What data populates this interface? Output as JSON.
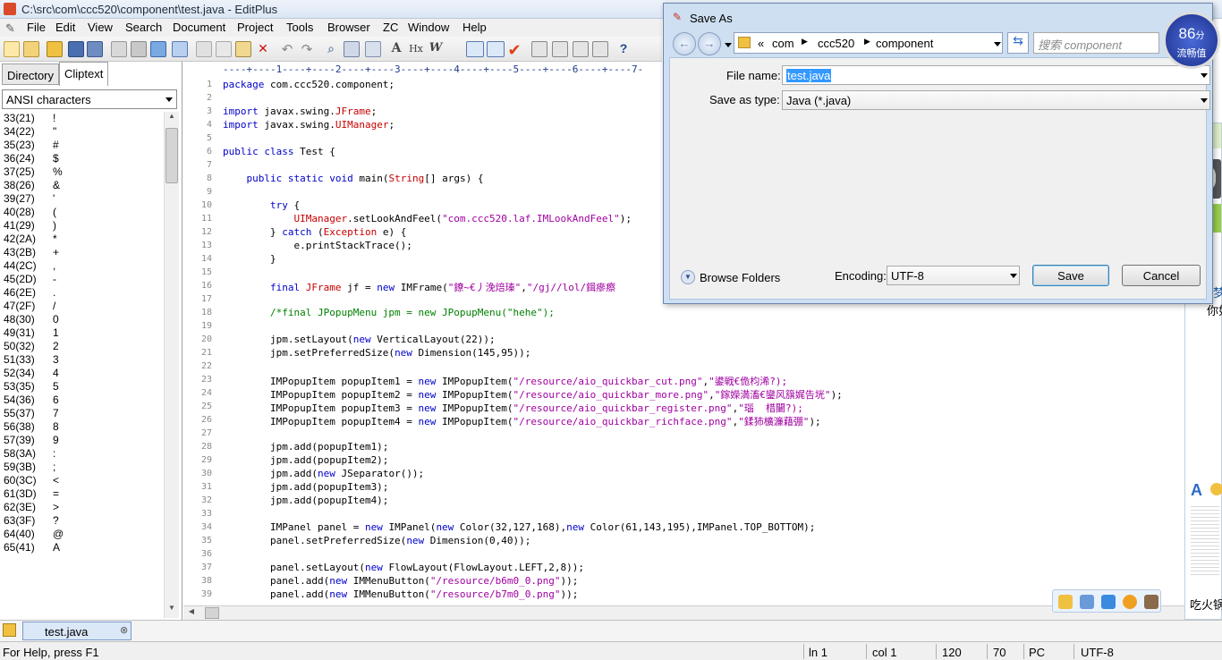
{
  "window": {
    "title": "C:\\src\\com\\ccc520\\component\\test.java - EditPlus"
  },
  "menu": [
    "File",
    "Edit",
    "View",
    "Search",
    "Document",
    "Project",
    "Tools",
    "Browser",
    "ZC",
    "Window",
    "Help"
  ],
  "left_panel": {
    "tabs": [
      "Directory",
      "Cliptext"
    ],
    "charset": "ANSI characters",
    "chars": [
      [
        "33(21)",
        "!"
      ],
      [
        "34(22)",
        "\""
      ],
      [
        "35(23)",
        "#"
      ],
      [
        "36(24)",
        "$"
      ],
      [
        "37(25)",
        "%"
      ],
      [
        "38(26)",
        "&"
      ],
      [
        "39(27)",
        "'"
      ],
      [
        "40(28)",
        "("
      ],
      [
        "41(29)",
        ")"
      ],
      [
        "42(2A)",
        "*"
      ],
      [
        "43(2B)",
        "+"
      ],
      [
        "44(2C)",
        ","
      ],
      [
        "45(2D)",
        "-"
      ],
      [
        "46(2E)",
        "."
      ],
      [
        "47(2F)",
        "/"
      ],
      [
        "48(30)",
        "0"
      ],
      [
        "49(31)",
        "1"
      ],
      [
        "50(32)",
        "2"
      ],
      [
        "51(33)",
        "3"
      ],
      [
        "52(34)",
        "4"
      ],
      [
        "53(35)",
        "5"
      ],
      [
        "54(36)",
        "6"
      ],
      [
        "55(37)",
        "7"
      ],
      [
        "56(38)",
        "8"
      ],
      [
        "57(39)",
        "9"
      ],
      [
        "58(3A)",
        ":"
      ],
      [
        "59(3B)",
        ";"
      ],
      [
        "60(3C)",
        "<"
      ],
      [
        "61(3D)",
        "="
      ],
      [
        "62(3E)",
        ">"
      ],
      [
        "63(3F)",
        "?"
      ],
      [
        "64(40)",
        "@"
      ],
      [
        "65(41)",
        "A"
      ]
    ]
  },
  "editor": {
    "ruler": "----+----1----+----2----+----3----+----4----+----5----+----6----+----7-",
    "lines": [
      {
        "n": "1",
        "t": "package com.ccc520.component;"
      },
      {
        "n": "2",
        "t": ""
      },
      {
        "n": "3",
        "t": "import javax.swing.JFrame;"
      },
      {
        "n": "4",
        "t": "import javax.swing.UIManager;"
      },
      {
        "n": "5",
        "t": ""
      },
      {
        "n": "6",
        "t": "public class Test {"
      },
      {
        "n": "7",
        "t": ""
      },
      {
        "n": "8",
        "t": "    public static void main(String[] args) {"
      },
      {
        "n": "9",
        "t": ""
      },
      {
        "n": "10",
        "t": "        try {"
      },
      {
        "n": "11",
        "t": "            UIManager.setLookAndFeel(\"com.ccc520.laf.IMLookAndFeel\");"
      },
      {
        "n": "12",
        "t": "        } catch (Exception e) {"
      },
      {
        "n": "13",
        "t": "            e.printStackTrace();"
      },
      {
        "n": "14",
        "t": "        }"
      },
      {
        "n": "15",
        "t": ""
      },
      {
        "n": "16",
        "t": "        final JFrame jf = new IMFrame(\"鐐~€丿浼焙瑧\",\"/gj//lol/鍓瘮瘵"
      },
      {
        "n": "17",
        "t": ""
      },
      {
        "n": "18",
        "t": "        /*final JPopupMenu jpm = new JPopupMenu(\"hehe\");"
      },
      {
        "n": "19",
        "t": ""
      },
      {
        "n": "20",
        "t": "        jpm.setLayout(new VerticalLayout(22));"
      },
      {
        "n": "21",
        "t": "        jpm.setPreferredSize(new Dimension(145,95));"
      },
      {
        "n": "22",
        "t": ""
      },
      {
        "n": "23",
        "t": "        IMPopupItem popupItem1 = new IMPopupItem(\"/resource/aio_quickbar_cut.png\",\"鍙戦€佹枃浠?);"
      },
      {
        "n": "24",
        "t": "        IMPopupItem popupItem2 = new IMPopupItem(\"/resource/aio_quickbar_more.png\",\"鎵嬫満滀€鑾风簱娓告垙\");"
      },
      {
        "n": "25",
        "t": "        IMPopupItem popupItem3 = new IMPopupItem(\"/resource/aio_quickbar_register.png\",\"瑙  棤闄?);"
      },
      {
        "n": "26",
        "t": "        IMPopupItem popupItem4 = new IMPopupItem(\"/resource/aio_quickbar_richface.png\",\"鍒犻櫎濂藉弸\");"
      },
      {
        "n": "27",
        "t": ""
      },
      {
        "n": "28",
        "t": "        jpm.add(popupItem1);"
      },
      {
        "n": "29",
        "t": "        jpm.add(popupItem2);"
      },
      {
        "n": "30",
        "t": "        jpm.add(new JSeparator());"
      },
      {
        "n": "31",
        "t": "        jpm.add(popupItem3);"
      },
      {
        "n": "32",
        "t": "        jpm.add(popupItem4);"
      },
      {
        "n": "33",
        "t": ""
      },
      {
        "n": "34",
        "t": "        IMPanel panel = new IMPanel(new Color(32,127,168),new Color(61,143,195),IMPanel.TOP_BOTTOM);"
      },
      {
        "n": "35",
        "t": "        panel.setPreferredSize(new Dimension(0,40));"
      },
      {
        "n": "36",
        "t": ""
      },
      {
        "n": "37",
        "t": "        panel.setLayout(new FlowLayout(FlowLayout.LEFT,2,8));"
      },
      {
        "n": "38",
        "t": "        panel.add(new IMMenuButton(\"/resource/b6m0_0.png\"));"
      },
      {
        "n": "39",
        "t": "        panel.add(new IMMenuButton(\"/resource/b7m0_0.png\"));"
      }
    ]
  },
  "file_tab": "test.java",
  "status": {
    "help": "For Help, press F1",
    "ln": "ln 1",
    "col": "col 1",
    "cols": "120",
    "rows": "70",
    "mode": "PC",
    "enc": "UTF-8"
  },
  "dialog": {
    "title": "Save As",
    "breadcrumb": [
      "«",
      "com",
      "ccc520",
      "component"
    ],
    "search_placeholder": "搜索 component",
    "filename_label": "File name:",
    "filename_value": "test.java",
    "type_label": "Save as type:",
    "type_value": "Java (*.java)",
    "browse": "Browse Folders",
    "enc_label": "Encoding:",
    "enc_value": "UTF-8",
    "save": "Save",
    "cancel": "Cancel"
  },
  "badge": {
    "value": "86",
    "unit": "分",
    "label": "流畅值"
  },
  "right_panel": {
    "text1": "抓住梦",
    "text2": "你如",
    "text3": "吃火锅"
  },
  "colors": {
    "keyword": "#0000c8",
    "type": "#c80000",
    "string": "#a000a0",
    "comment": "#008000",
    "accent": "#3399ff"
  }
}
